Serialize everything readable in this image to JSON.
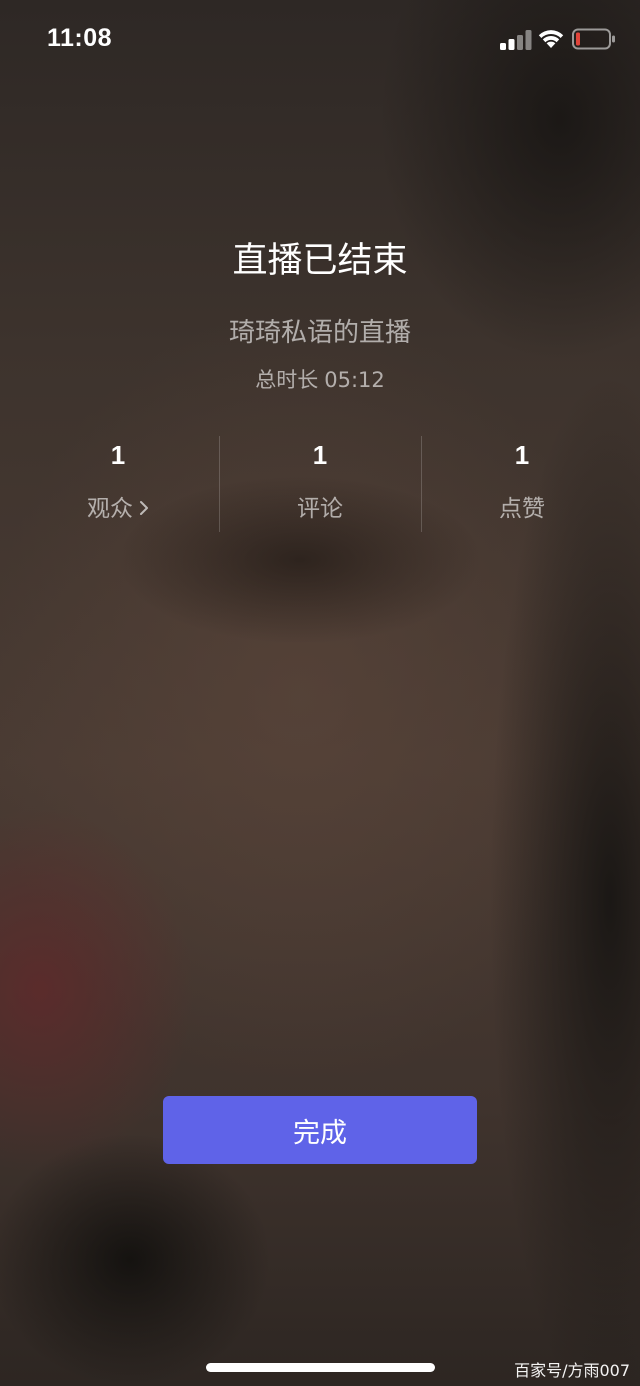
{
  "status_bar": {
    "time": "11:08",
    "icons": [
      "signal-icon",
      "wifi-icon",
      "battery-low-icon"
    ],
    "battery_color": "#e0443a"
  },
  "live_end": {
    "title": "直播已结束",
    "streamer_line": "琦琦私语的直播",
    "duration_label": "总时长",
    "duration_value": "05:12"
  },
  "stats": [
    {
      "value": "1",
      "label": "观众",
      "has_chevron": true
    },
    {
      "value": "1",
      "label": "评论"
    },
    {
      "value": "1",
      "label": "点赞"
    }
  ],
  "done_button": {
    "label": "完成",
    "color": "#5f63e8"
  },
  "watermark": "百家号/方雨007"
}
